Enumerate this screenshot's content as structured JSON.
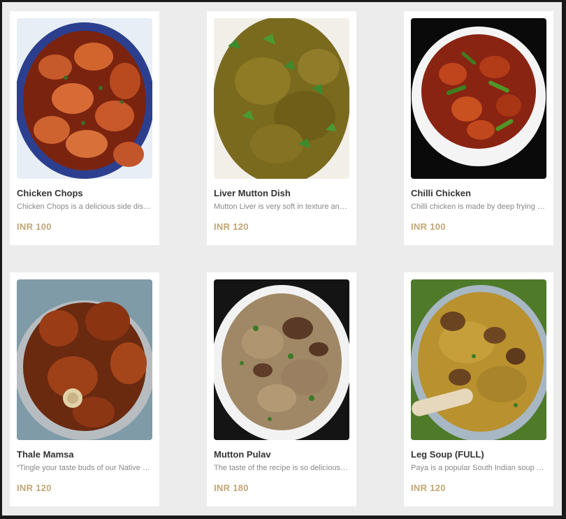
{
  "menu": {
    "items": [
      {
        "name": "Chicken Chops",
        "description": "Chicken Chops is a delicious side dish made with chicken pieces",
        "price": "INR 100",
        "image": "chicken-chops-photo"
      },
      {
        "name": "Liver Mutton Dish",
        "description": "Mutton Liver is very soft in texture and very tasty",
        "price": "INR 120",
        "image": "liver-mutton-photo"
      },
      {
        "name": "Chilli Chicken",
        "description": "Chilli chicken is made by deep frying chicken pieces",
        "price": "INR 100",
        "image": "chilli-chicken-photo"
      },
      {
        "name": "Thale Mamsa",
        "description": "“Tingle your taste buds of our Native recipes",
        "price": "INR 120",
        "image": "thale-mamsa-photo"
      },
      {
        "name": "Mutton Pulav",
        "description": "The taste of the recipe is so delicious and flavorful",
        "price": "INR 180",
        "image": "mutton-pulav-photo"
      },
      {
        "name": "Leg Soup (FULL)",
        "description": "Paya is a popular South Indian soup made with goat legs",
        "price": "INR 120",
        "image": "leg-soup-photo"
      }
    ]
  }
}
